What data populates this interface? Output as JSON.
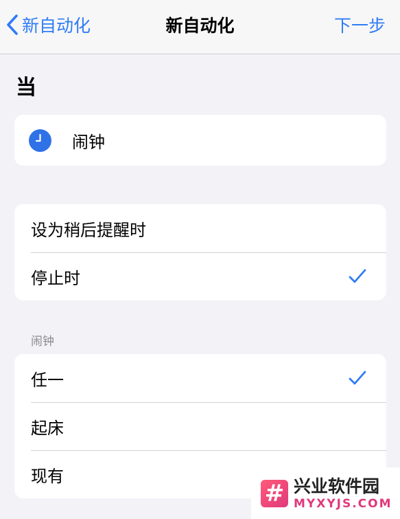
{
  "navbar": {
    "back_label": "新自动化",
    "title": "新自动化",
    "next_label": "下一步"
  },
  "section_heading": "当",
  "trigger": {
    "label": "闹钟",
    "icon": "clock-icon"
  },
  "event_options": [
    {
      "label": "设为稍后提醒时",
      "checked": false
    },
    {
      "label": "停止时",
      "checked": true
    }
  ],
  "alarm_group": {
    "header": "闹钟",
    "options": [
      {
        "label": "任一",
        "checked": true
      },
      {
        "label": "起床",
        "checked": false
      },
      {
        "label": "现有",
        "checked": false
      }
    ]
  },
  "watermark": {
    "logo_glyph": "#",
    "name": "兴业软件园",
    "url": "MYXYJS.COM"
  },
  "colors": {
    "accent": "#2f7cf6",
    "background": "#f2f2f7",
    "card": "#ffffff",
    "clock_icon": "#2f72e8"
  }
}
